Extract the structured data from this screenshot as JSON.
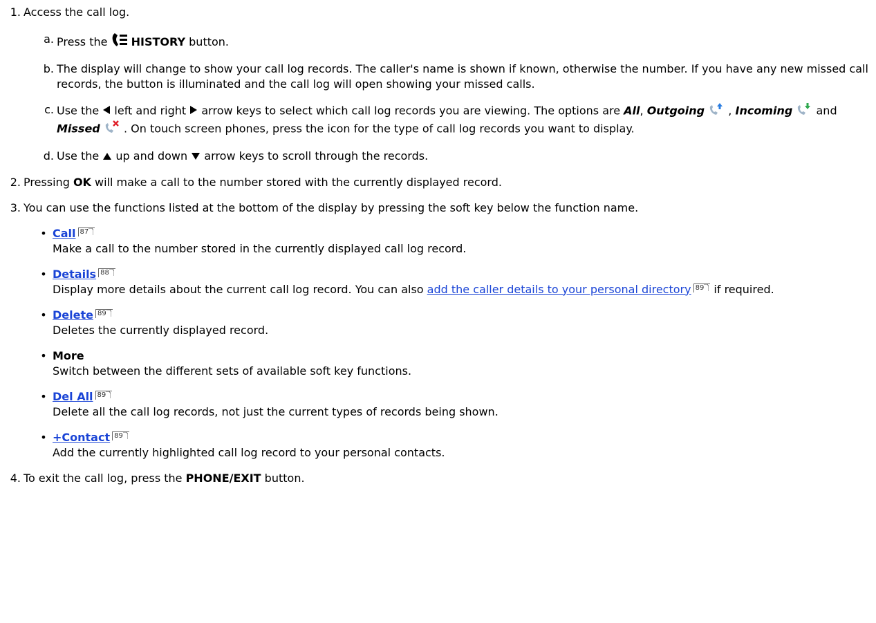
{
  "steps": [
    {
      "num": "1.",
      "text": "Access the call log."
    },
    {
      "num": "2.",
      "pre": "Pressing ",
      "bold": "OK",
      "post": " will make a call to the number stored with the currently displayed record."
    },
    {
      "num": "3.",
      "text": "You can use the functions listed at the bottom of the display by pressing the soft key below the function name."
    },
    {
      "num": "4.",
      "pre": "To exit the call log, press the ",
      "bold": "PHONE/EXIT",
      "post": " button."
    }
  ],
  "substeps": {
    "a": {
      "num": "a.",
      "pre": "Press the ",
      "bold": "HISTORY",
      "post": " button."
    },
    "b": {
      "num": "b.",
      "text": "The display will change to show your call log records. The caller's name is shown if known, otherwise the number. If you have any new missed call records, the button is illuminated and the call log will open showing your missed calls."
    },
    "c": {
      "num": "c.",
      "t1": "Use the ",
      "t2": " left and right ",
      "t3": " arrow keys to select which call log records you are viewing. The options are ",
      "all": "All",
      "comma1": ", ",
      "outgoing": "Outgoing",
      "comma2": " , ",
      "incoming": "Incoming",
      "and": " and ",
      "missed": "Missed",
      "t4": " . On touch screen phones, press the icon for the type of call log records you want to display."
    },
    "d": {
      "num": "d.",
      "t1": "Use the ",
      "t2": " up and down ",
      "t3": " arrow keys to scroll through the records."
    }
  },
  "functions": [
    {
      "label": "Call",
      "ref": "87",
      "desc": "Make a call to the number stored in the currently displayed call log record."
    },
    {
      "label": "Details",
      "ref": "88",
      "desc1": "Display more details about the current call log record. You can also ",
      "link": "add the caller details to your personal directory",
      "linkref": "89",
      "desc2": " if required."
    },
    {
      "label": "Delete",
      "ref": "89",
      "desc": "Deletes the currently displayed record."
    },
    {
      "label": "More",
      "desc": "Switch between the different sets of available soft key functions."
    },
    {
      "label": "Del All",
      "ref": "89",
      "desc": "Delete all the call log records, not just the current types of records being shown."
    },
    {
      "label": "+Contact",
      "ref": "89",
      "desc": "Add the currently highlighted call log record to your personal contacts."
    }
  ],
  "bullet": "•",
  "icons": {
    "history": "history-phone-icon",
    "left": "left-arrow-icon",
    "right": "right-arrow-icon",
    "up": "up-arrow-icon",
    "down": "down-arrow-icon",
    "outgoing": "outgoing-call-icon",
    "incoming": "incoming-call-icon",
    "missed": "missed-call-icon"
  },
  "colors": {
    "link": "#1a44d6",
    "outgoing_arrow": "#2a7de1",
    "incoming_arrow": "#2fa84f",
    "missed_x": "#e0202a",
    "phone": "#9fb4c8"
  }
}
